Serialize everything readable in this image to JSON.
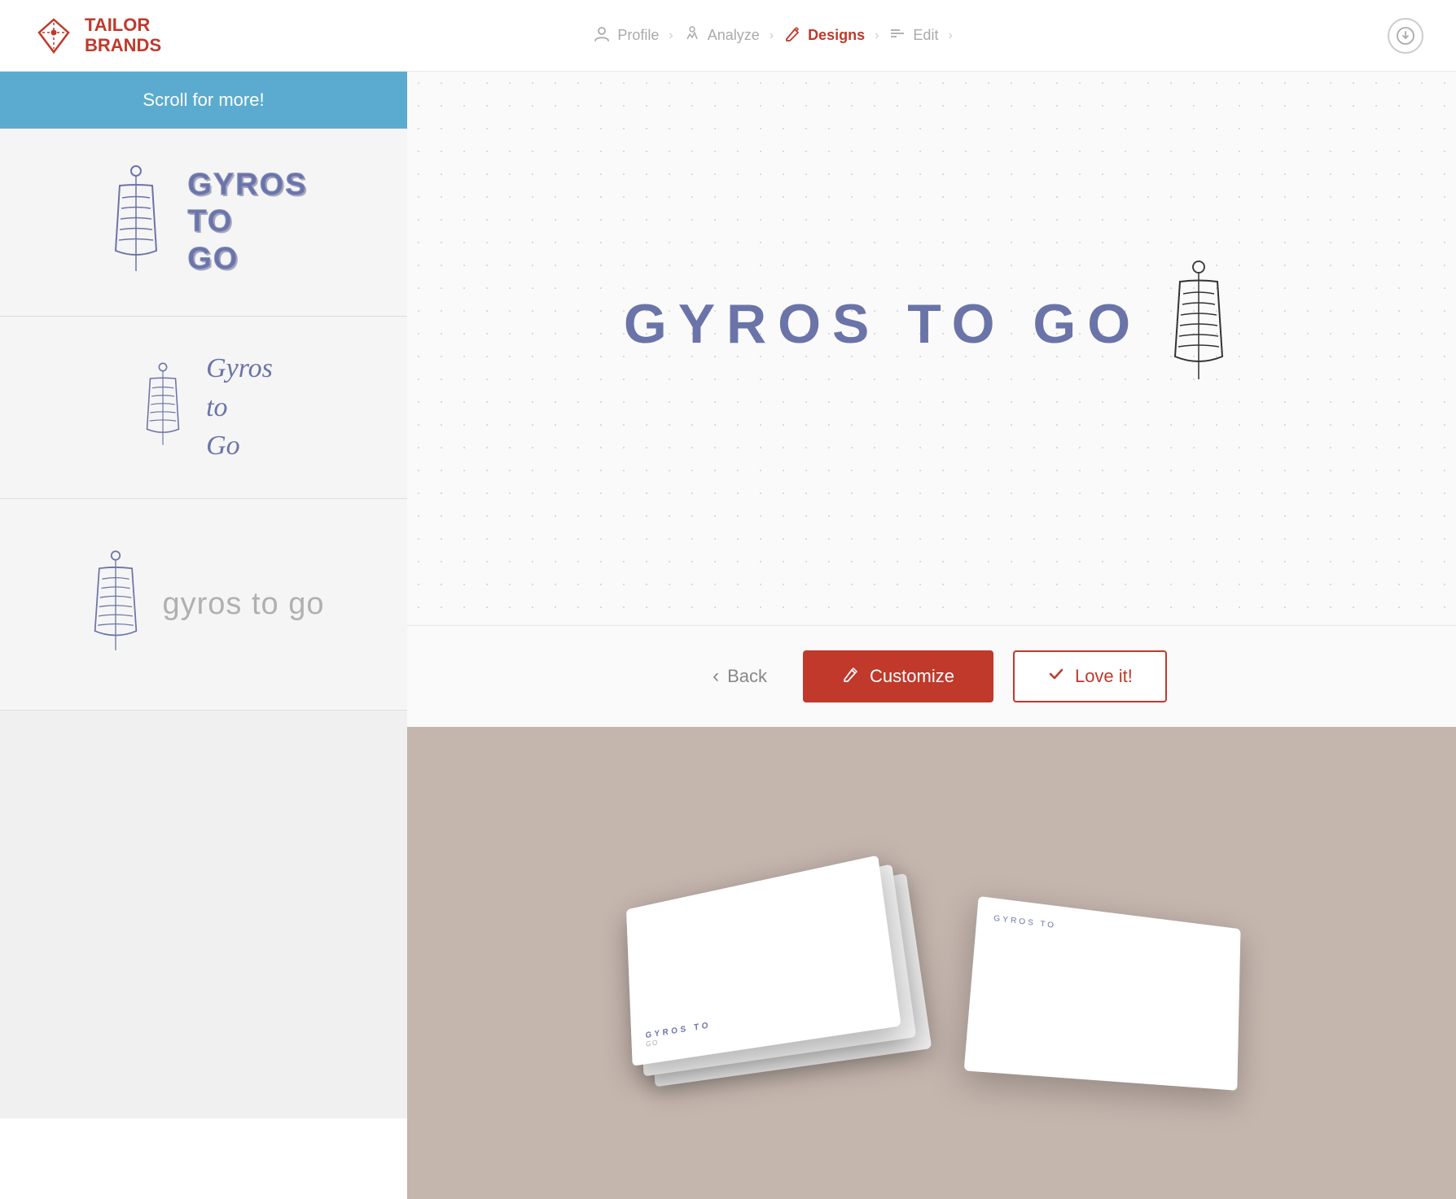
{
  "brand": {
    "name_line1": "TAILOR",
    "name_line2": "BRANDS",
    "icon_alt": "tailor-brands-logo"
  },
  "nav": {
    "steps": [
      {
        "id": "profile",
        "label": "Profile",
        "icon": "👤",
        "active": false
      },
      {
        "id": "analyze",
        "label": "Analyze",
        "icon": "⑂",
        "active": false
      },
      {
        "id": "designs",
        "label": "Designs",
        "icon": "✏️",
        "active": true
      },
      {
        "id": "edit",
        "label": "Edit",
        "icon": "≡",
        "active": false
      }
    ]
  },
  "sidebar": {
    "scroll_banner": "Scroll for more!",
    "variants": [
      {
        "id": "variant-1",
        "style": "bold-block",
        "brand_name_lines": [
          "GYROS",
          "TO",
          "GO"
        ]
      },
      {
        "id": "variant-2",
        "style": "italic-script",
        "brand_name_lines": [
          "Gyros",
          "to",
          "Go"
        ]
      },
      {
        "id": "variant-3",
        "style": "lowercase-thin",
        "brand_name_lines": [
          "gyros to go"
        ]
      }
    ]
  },
  "preview": {
    "main_text": "GYROS TO GO",
    "back_label": "Back",
    "customize_label": "Customize",
    "loveit_label": "Love it!"
  },
  "mockup": {
    "card_logo": "GYROS TO",
    "card_subtitle": "GO"
  }
}
